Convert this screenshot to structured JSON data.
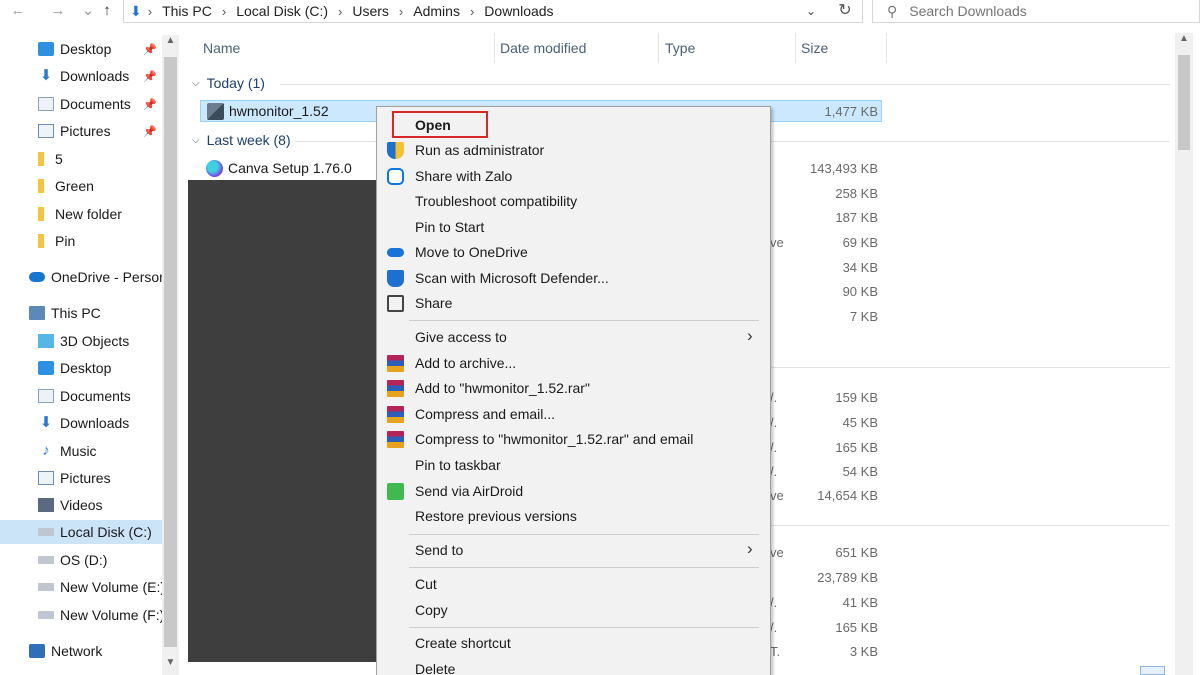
{
  "address_bar": {
    "back_icon": "back-arrow-icon",
    "forward_icon": "forward-arrow-icon",
    "up_icon": "up-arrow-icon",
    "breadcrumbs": [
      "This PC",
      "Local Disk (C:)",
      "Users",
      "Admins",
      "Downloads"
    ],
    "search_placeholder": "Search Downloads"
  },
  "sidebar": {
    "quick_access": [
      {
        "label": "Desktop",
        "icon": "desktop-icon",
        "pinned": true
      },
      {
        "label": "Downloads",
        "icon": "downloads-icon",
        "pinned": true
      },
      {
        "label": "Documents",
        "icon": "documents-icon",
        "pinned": true
      },
      {
        "label": "Pictures",
        "icon": "pictures-icon",
        "pinned": true
      },
      {
        "label": "5",
        "icon": "folder-icon"
      },
      {
        "label": "Green",
        "icon": "folder-icon"
      },
      {
        "label": "New folder",
        "icon": "folder-icon"
      },
      {
        "label": "Pin",
        "icon": "folder-icon"
      }
    ],
    "onedrive": "OneDrive - Person",
    "this_pc": "This PC",
    "pc_items": [
      {
        "label": "3D Objects",
        "icon": "3d-objects-icon"
      },
      {
        "label": "Desktop",
        "icon": "desktop-icon"
      },
      {
        "label": "Documents",
        "icon": "documents-icon"
      },
      {
        "label": "Downloads",
        "icon": "downloads-icon"
      },
      {
        "label": "Music",
        "icon": "music-icon"
      },
      {
        "label": "Pictures",
        "icon": "pictures-icon"
      },
      {
        "label": "Videos",
        "icon": "videos-icon"
      },
      {
        "label": "Local Disk (C:)",
        "icon": "local-disk-icon",
        "selected": true
      },
      {
        "label": "OS (D:)",
        "icon": "drive-icon"
      },
      {
        "label": "New Volume (E:)",
        "icon": "drive-icon"
      },
      {
        "label": "New Volume (F:)",
        "icon": "drive-icon"
      }
    ],
    "network": "Network"
  },
  "columns": {
    "name": "Name",
    "date_modified": "Date modified",
    "type": "Type",
    "size": "Size"
  },
  "groups": {
    "today": "Today (1)",
    "last_week": "Last week (8)"
  },
  "files": {
    "hwmonitor": {
      "name": "hwmonitor_1.52",
      "size": "1,477 KB"
    },
    "canva": {
      "name": "Canva Setup 1.76.0",
      "size": "143,493 KB"
    }
  },
  "sizes_visible": [
    "258 KB",
    "187 KB",
    "69 KB",
    "34 KB",
    "90 KB",
    "7 KB",
    "159 KB",
    "45 KB",
    "165 KB",
    "54 KB",
    "14,654 KB",
    "651 KB",
    "23,789 KB",
    "41 KB",
    "165 KB",
    "3 KB"
  ],
  "type_fragments": [
    "ve",
    "/.",
    "/.",
    "/.",
    "/.",
    "ve",
    "ve",
    "/.",
    "/.",
    "T."
  ],
  "context_menu": {
    "open": "Open",
    "run_as_admin": "Run as administrator",
    "share_zalo": "Share with Zalo",
    "troubleshoot": "Troubleshoot compatibility",
    "pin_start": "Pin to Start",
    "move_onedrive": "Move to OneDrive",
    "scan_defender": "Scan with Microsoft Defender...",
    "share": "Share",
    "give_access": "Give access to",
    "add_archive": "Add to archive...",
    "add_rar": "Add to \"hwmonitor_1.52.rar\"",
    "compress_email": "Compress and email...",
    "compress_rar_email": "Compress to \"hwmonitor_1.52.rar\" and email",
    "pin_taskbar": "Pin to taskbar",
    "send_airdroid": "Send via AirDroid",
    "restore_versions": "Restore previous versions",
    "send_to": "Send to",
    "cut": "Cut",
    "copy": "Copy",
    "create_shortcut": "Create shortcut",
    "delete": "Delete"
  },
  "colors": {
    "selection": "#cce8ff",
    "highlight_box": "#d62828",
    "menu_bg": "#f2f2f2"
  }
}
